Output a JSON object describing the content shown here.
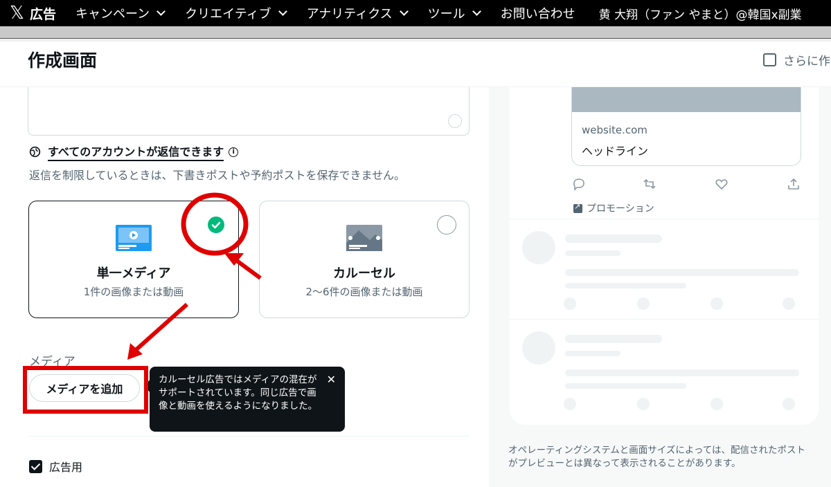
{
  "topnav": {
    "brand_label": "広告",
    "items": [
      {
        "label": "キャンペーン"
      },
      {
        "label": "クリエイティブ"
      },
      {
        "label": "アナリティクス"
      },
      {
        "label": "ツール"
      },
      {
        "label": "お問い合わせ"
      }
    ],
    "account": "黄 大翔（ファン やまと）@韓国x副業"
  },
  "header": {
    "title": "作成画面",
    "more_options_label": "さらに作"
  },
  "compose": {
    "reply_setting": "すべてのアカウントが返信できます",
    "reply_note": "返信を制限しているときは、下書きポストや予約ポストを保存できません。",
    "formats": [
      {
        "title": "単一メディア",
        "subtitle": "1件の画像または動画",
        "selected": true
      },
      {
        "title": "カルーセル",
        "subtitle": "2〜6件の画像または動画",
        "selected": false
      }
    ],
    "media_label": "メディア",
    "add_media_button": "メディアを追加",
    "tooltip": "カルーセル広告ではメディアの混在がサポートされています。同じ広告で画像と動画を使えるようになりました。",
    "ad_checkbox_label": "広告用",
    "ad_checkbox_checked": true
  },
  "preview": {
    "link_domain": "website.com",
    "link_headline": "ヘッドライン",
    "promoted_label": "プロモーション",
    "footnote": "オペレーティングシステムと画面サイズによっては、配信されたポストがプレビューとは異なって表示されることがあります。"
  },
  "icons": {
    "brand": "x-logo-icon",
    "reply": "globe-icon",
    "info": "info-icon",
    "check": "check-icon",
    "close": "close-icon",
    "actions": [
      "reply-icon",
      "repost-icon",
      "like-icon",
      "share-icon"
    ]
  },
  "colors": {
    "accent_green": "#00ba7c",
    "annotation_red": "#e00000",
    "tooltip_bg": "#0f1419"
  }
}
